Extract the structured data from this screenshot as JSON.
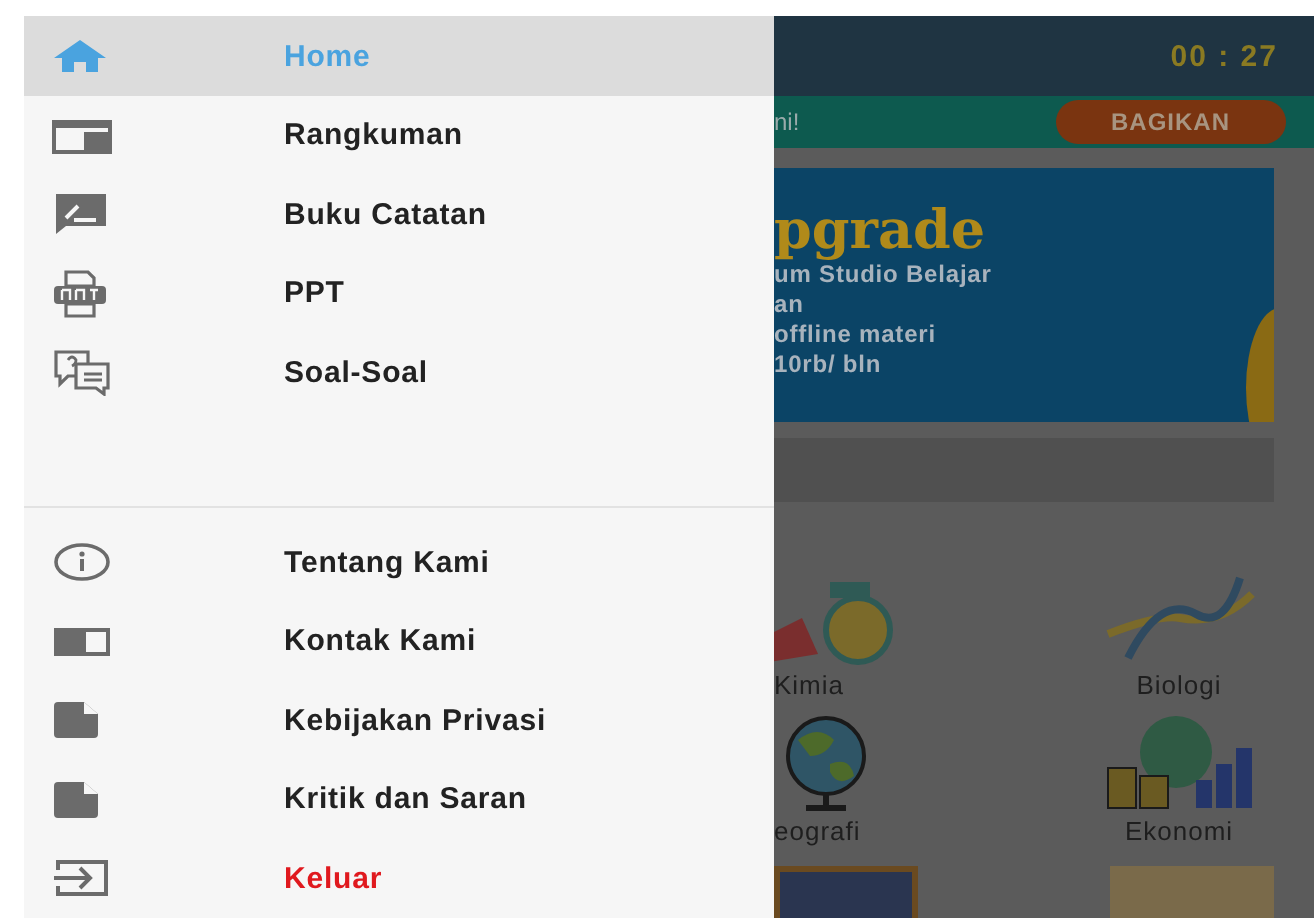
{
  "drawer": {
    "items": [
      {
        "label": "Home",
        "kind": "home",
        "selected": true
      },
      {
        "label": "Rangkuman",
        "kind": "summary",
        "selected": false
      },
      {
        "label": "Buku Catatan",
        "kind": "note",
        "selected": false
      },
      {
        "label": "PPT",
        "kind": "ppt",
        "selected": false
      },
      {
        "label": "Soal-Soal",
        "kind": "quiz",
        "selected": false
      }
    ],
    "footer_items": [
      {
        "label": "Tentang Kami",
        "kind": "info",
        "selected": false
      },
      {
        "label": "Kontak Kami",
        "kind": "book",
        "selected": false
      },
      {
        "label": "Kebijakan Privasi",
        "kind": "doc",
        "selected": false
      },
      {
        "label": "Kritik dan Saran",
        "kind": "doc",
        "selected": false
      },
      {
        "label": "Keluar",
        "kind": "logout",
        "selected": false
      }
    ]
  },
  "app_behind": {
    "timer": "00 : 27",
    "notice": "ni!",
    "share_button": "BAGIKAN",
    "promo": {
      "title": "pgrade",
      "lines": [
        "um Studio Belajar",
        "an",
        "offline materi",
        "10rb/ bln"
      ]
    },
    "subjects": [
      {
        "label": "Kimia",
        "kind": "flask"
      },
      {
        "label": "Biologi",
        "kind": "dna"
      },
      {
        "label": "eografi",
        "kind": "globe"
      },
      {
        "label": "Ekonomi",
        "kind": "economy"
      }
    ]
  }
}
